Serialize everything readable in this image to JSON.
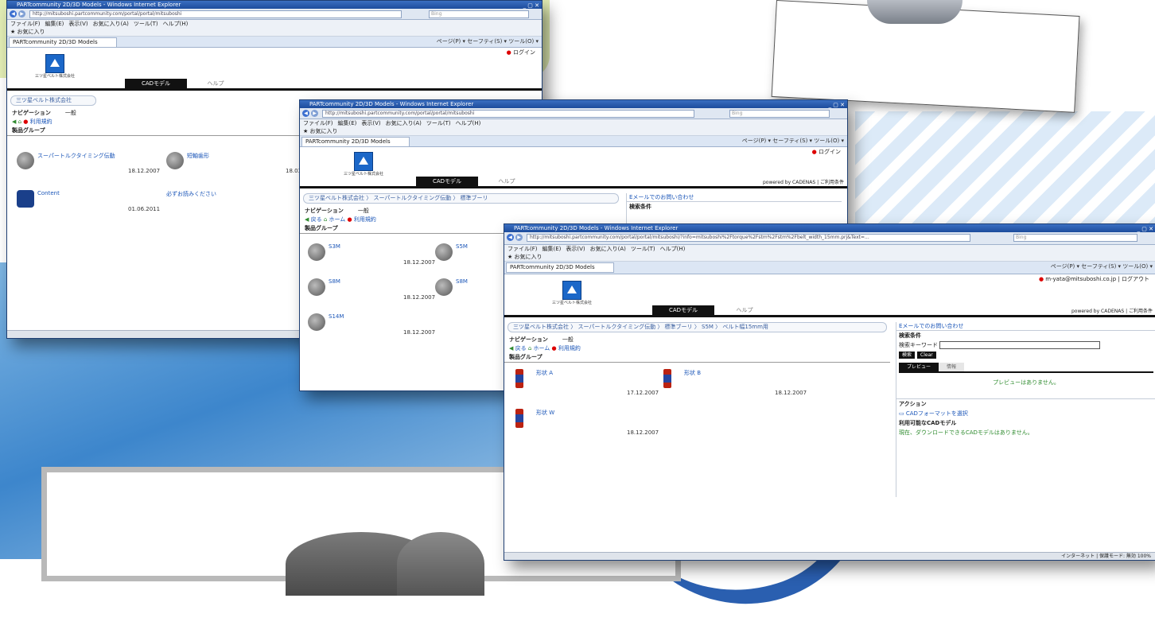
{
  "browser": {
    "window_title": "PARTcommunity 2D/3D Models - Windows Internet Explorer",
    "url_w1": "http://mitsuboshi.partcommunity.com/portal/portal/mitsuboshi",
    "url_w2": "http://mitsuboshi.partcommunity.com/portal/portal/mitsuboshi",
    "url_w3": "http://mitsuboshi.partcommunity.com/portal/portal/mitsuboshi/?info=mitsuboshi%2Ftorque%2Fstm%2Fstm%2Fbelt_width_15mm.prj&Text=...",
    "search_placeholder": "Bing",
    "menu_items": [
      "ファイル(F)",
      "編集(E)",
      "表示(V)",
      "お気に入り(A)",
      "ツール(T)",
      "ヘルプ(H)"
    ],
    "favorites": "お気に入り",
    "tab_title": "PARTcommunity 2D/3D Models",
    "toolbar_tools": "ページ(P) ▾  セーフティ(S) ▾  ツール(O) ▾",
    "status_text": "インターネット | 保護モード: 無効    100%"
  },
  "site": {
    "brand_small": "三ツ星ベルト株式会社",
    "cad_tab": "CADモデル",
    "help_tab": "ヘルプ",
    "login": "ログイン",
    "user_email": "m-yata@mitsuboshi.co.jp",
    "logout": "ログアウト",
    "powered": "powered by CADENAS  |  ご利用条件",
    "nav_title": "ナビゲーション",
    "general": "一般",
    "back": "戻る",
    "home": "ホーム",
    "terms": "利用規約",
    "product_group": "製品グループ"
  },
  "window1": {
    "breadcrumb": "三ツ星ベルト株式会社",
    "items": [
      {
        "label": "スーパートルクタイミング伝動",
        "date": "18.12.2007"
      },
      {
        "label": "短軸歯形",
        "date": "18.03."
      },
      {
        "label": "Content",
        "date": "01.06.2011"
      },
      {
        "label": "必ずお読みください",
        "date": ""
      }
    ]
  },
  "window2": {
    "breadcrumb": "三ツ星ベルト株式会社 〉 スーパートルクタイミング伝動 〉 標準ブーリ",
    "items": [
      {
        "label": "S3M",
        "date": "18.12.2007"
      },
      {
        "label": "S5M",
        "date": "18.12.2007"
      },
      {
        "label": "S8M",
        "date": "18.12.2007"
      },
      {
        "label": "S8M",
        "date": "18.12.2007"
      },
      {
        "label": "S14M",
        "date": "18.12.2007"
      }
    ],
    "rp_link": "Eメールでのお問い合わせ",
    "rp_head": "検索条件"
  },
  "window3": {
    "breadcrumb": "三ツ星ベルト株式会社 〉 スーパートルクタイミング伝動 〉 標準ブーリ 〉 S5M 〉 ベルト幅15mm用",
    "items": [
      {
        "label": "形状 A",
        "date": "17.12.2007"
      },
      {
        "label": "形状 B",
        "date": "18.12.2007"
      },
      {
        "label": "形状 W",
        "date": "18.12.2007"
      }
    ],
    "rp_link": "Eメールでのお問い合わせ",
    "rp_search_head": "検索条件",
    "rp_keyword": "検索キーワード",
    "rp_search_btn": "検索",
    "rp_clear_btn": "Clear",
    "rp_preview_tab": "プレビュー",
    "rp_info_tab": "情報",
    "rp_no_preview": "プレビューはありません。",
    "rp_action": "アクション",
    "rp_cad_format": "CADフォーマットを選択",
    "rp_available": "利用可能なCADモデル",
    "rp_no_model": "現在、ダウンロードできるCADモデルはありません。"
  },
  "colors": {
    "accent": "#1b56b8",
    "window_title": "#2a5fb0",
    "ok_green": "#2e8b2e",
    "alert_red": "#dd0000"
  }
}
